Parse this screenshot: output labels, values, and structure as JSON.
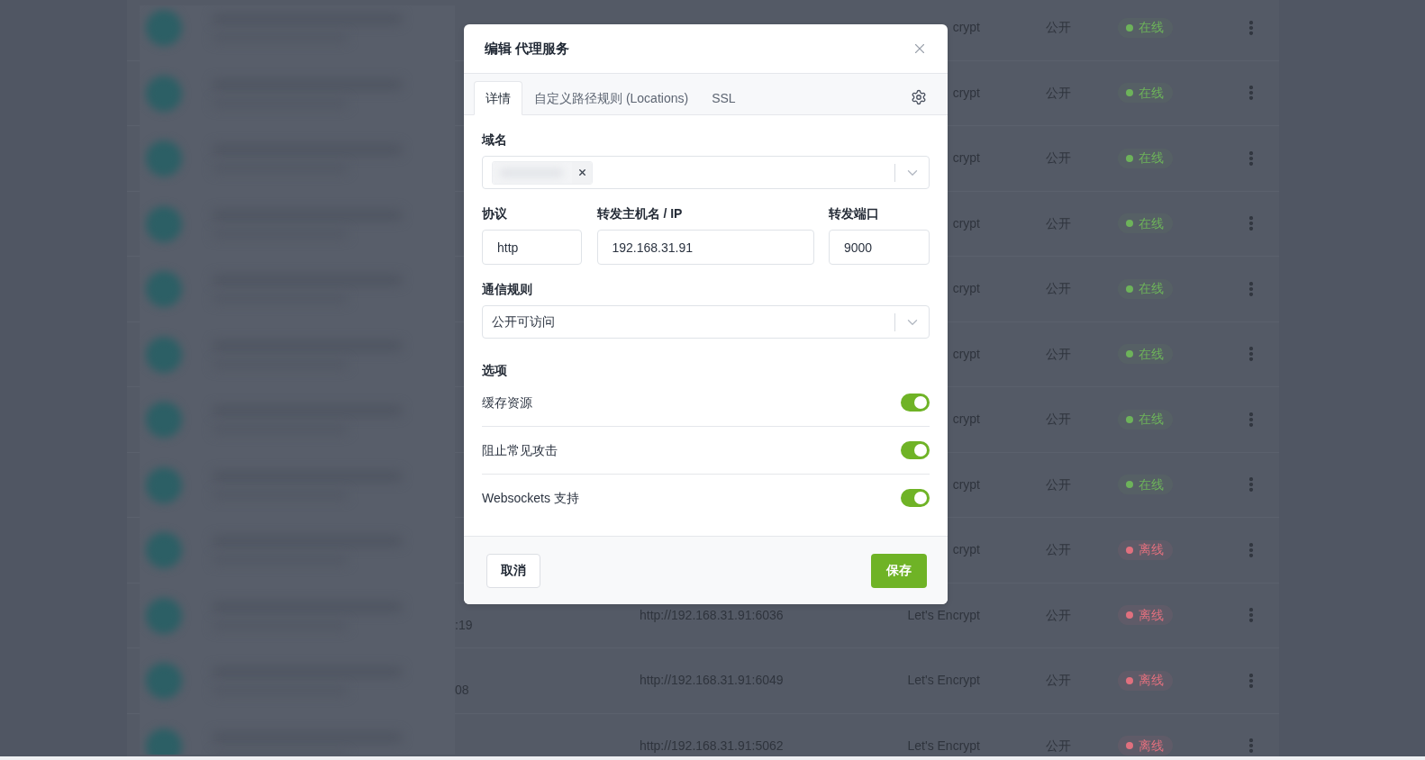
{
  "table": {
    "rows": [
      {
        "column_4": "crypt",
        "column_5": "公开",
        "column_6": {
          "label": "在线",
          "color": "#6db35a"
        }
      },
      {
        "column_4": "crypt",
        "column_5": "公开",
        "column_6": {
          "label": "在线",
          "color": "#6db35a"
        }
      },
      {
        "column_4": "crypt",
        "column_5": "公开",
        "column_6": {
          "label": "在线",
          "color": "#6db35a"
        }
      },
      {
        "column_4": "crypt",
        "column_5": "公开",
        "column_6": {
          "label": "在线",
          "color": "#6db35a"
        }
      },
      {
        "column_4": "crypt",
        "column_5": "公开",
        "column_6": {
          "label": "在线",
          "color": "#6db35a"
        }
      },
      {
        "column_4": "crypt",
        "column_5": "公开",
        "column_6": {
          "label": "在线",
          "color": "#6db35a"
        }
      },
      {
        "column_4": "crypt",
        "column_5": "公开",
        "column_6": {
          "label": "在线",
          "color": "#6db35a"
        }
      },
      {
        "column_4": "crypt",
        "column_5": "公开",
        "column_6": {
          "label": "在线",
          "color": "#6db35a"
        }
      },
      {
        "column_4": "crypt",
        "column_5": "公开",
        "column_6": {
          "label": "离线",
          "color": "#e0707e"
        }
      },
      {
        "column_2": ":19",
        "column_3": "http://192.168.31.91:6036",
        "column_4": "Let's Encrypt",
        "column_5": "公开",
        "column_6": {
          "label": "离线",
          "color": "#e0707e"
        }
      },
      {
        "column_2": "08",
        "column_3": "http://192.168.31.91:6049",
        "column_4": "Let's Encrypt",
        "column_5": "公开",
        "column_6": {
          "label": "离线",
          "color": "#e0707e"
        }
      },
      {
        "column_3": "http://192.168.31.91:5062",
        "column_4": "Let's Encrypt",
        "column_5": "公开",
        "column_6": {
          "label": "离线",
          "color": "#e0707e"
        }
      }
    ]
  },
  "dialog": {
    "title": "编辑 代理服务",
    "tabs": [
      {
        "label": "详情",
        "selected": true
      },
      {
        "label": "自定义路径规则 (Locations)",
        "selected": false
      },
      {
        "label": "SSL",
        "selected": false
      }
    ],
    "domain": {
      "label": "域名"
    },
    "protocol": {
      "label": "协议",
      "value": "http"
    },
    "forward_host": {
      "label": "转发主机名 / IP",
      "value": "192.168.31.91"
    },
    "forward_port": {
      "label": "转发端口",
      "value": "9000"
    },
    "access_rule": {
      "label": "通信规则",
      "value": "公开可访问"
    },
    "options": {
      "title": "选项",
      "items": [
        {
          "label": "缓存资源",
          "on": true
        },
        {
          "label": "阻止常见攻击",
          "on": true
        },
        {
          "label": "Websockets 支持",
          "on": true
        }
      ]
    },
    "buttons": {
      "cancel": "取消",
      "save": "保存"
    }
  }
}
